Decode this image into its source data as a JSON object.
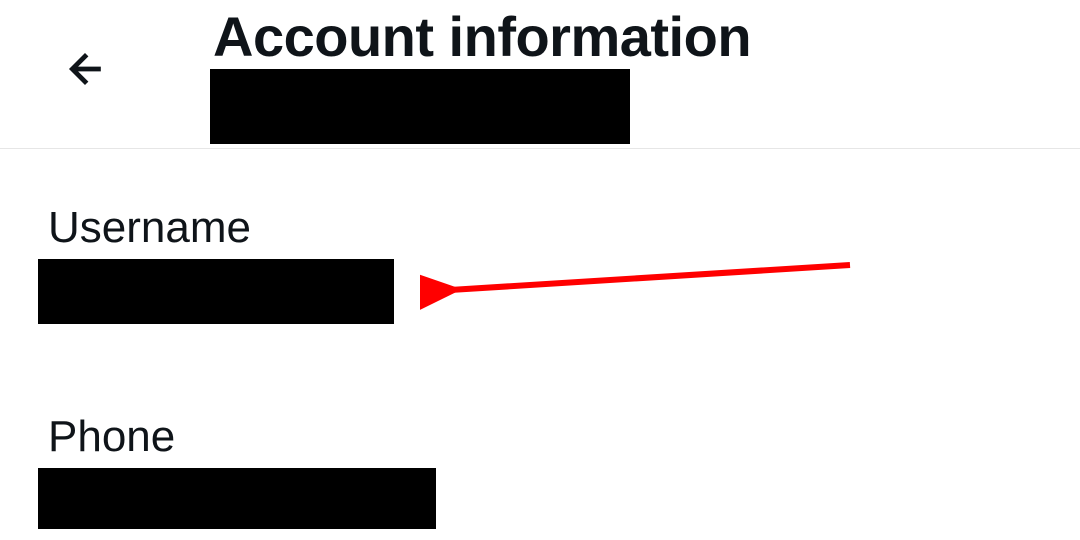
{
  "header": {
    "title": "Account information",
    "back_icon": "arrow-left"
  },
  "fields": {
    "username": {
      "label": "Username",
      "value_redacted": true
    },
    "phone": {
      "label": "Phone",
      "value_redacted": true
    }
  },
  "annotation": {
    "type": "arrow",
    "color": "#ff0000",
    "points_to": "username-value"
  }
}
